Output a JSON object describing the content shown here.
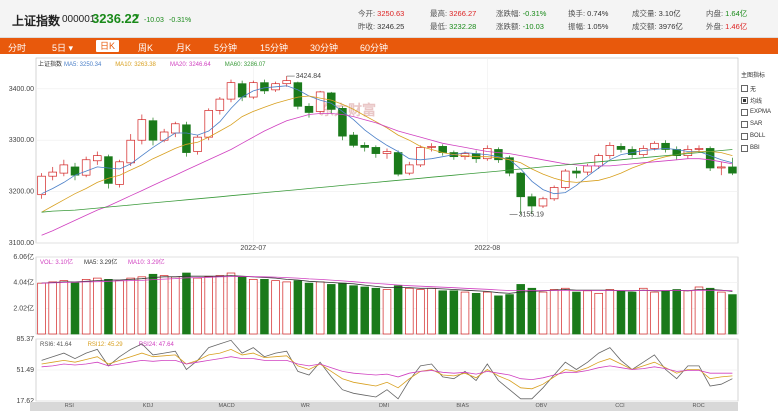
{
  "header": {
    "name": "上证指数",
    "code": "000001",
    "price": "3236.22",
    "arrow": "▼",
    "change": "-10.03",
    "change_pct": "-0.31%",
    "stats": [
      {
        "label": "今开:",
        "value": "3250.63",
        "tone": "red"
      },
      {
        "label": "最高:",
        "value": "3266.27",
        "tone": "red"
      },
      {
        "label": "涨跌幅:",
        "value": "-0.31%",
        "tone": "grn"
      },
      {
        "label": "换手:",
        "value": "0.74%",
        "tone": "normal"
      },
      {
        "label": "成交量:",
        "value": "3.10亿",
        "tone": "normal"
      },
      {
        "label": "内盘:",
        "value": "1.64亿",
        "tone": "grn"
      },
      {
        "label": "昨收:",
        "value": "3246.25",
        "tone": "normal"
      },
      {
        "label": "最低:",
        "value": "3232.28",
        "tone": "grn"
      },
      {
        "label": "涨跌额:",
        "value": "-10.03",
        "tone": "grn"
      },
      {
        "label": "振幅:",
        "value": "1.05%",
        "tone": "normal"
      },
      {
        "label": "成交额:",
        "value": "3976亿",
        "tone": "normal"
      },
      {
        "label": "外盘:",
        "value": "1.46亿",
        "tone": "red"
      }
    ]
  },
  "tabs": [
    {
      "label": "分时",
      "active": false
    },
    {
      "label": "5日 ▾",
      "active": false
    },
    {
      "label": "日K",
      "active": true
    },
    {
      "label": "周K",
      "active": false
    },
    {
      "label": "月K",
      "active": false
    },
    {
      "label": "5分钟",
      "active": false
    },
    {
      "label": "15分钟",
      "active": false
    },
    {
      "label": "30分钟",
      "active": false
    },
    {
      "label": "60分钟",
      "active": false
    }
  ],
  "sidebar": {
    "title": "主图指标",
    "options": [
      {
        "label": "无",
        "checked": false
      },
      {
        "label": "均线",
        "checked": true
      },
      {
        "label": "EXPMA",
        "checked": false
      },
      {
        "label": "SAR",
        "checked": false
      },
      {
        "label": "BOLL",
        "checked": false
      },
      {
        "label": "BBI",
        "checked": false
      }
    ]
  },
  "watermark": "东方财富",
  "index_bar": [
    "RSI",
    "KDJ",
    "MACD",
    "WR",
    "DMI",
    "BIAS",
    "OBV",
    "CCI",
    "ROC"
  ],
  "colors": {
    "up": "#d22222",
    "down": "#1a7a1a",
    "ma5": "#4a7fc8",
    "ma10": "#d8a020",
    "ma20": "#d040c0",
    "ma60": "#3a9a3a"
  },
  "chart_data": [
    {
      "type": "candlestick",
      "title": "上证指数",
      "legend": [
        {
          "name": "MA5",
          "value": "3250.34",
          "color": "#4a7fc8"
        },
        {
          "name": "MA10",
          "value": "3263.38",
          "color": "#d8a020"
        },
        {
          "name": "MA20",
          "value": "3246.64",
          "color": "#d040c0"
        },
        {
          "name": "MA60",
          "value": "3286.07",
          "color": "#3a9a3a"
        }
      ],
      "ylim": [
        3100,
        3460
      ],
      "yticks": [
        "3400.00",
        "3300.00",
        "3200.00",
        "3100.00"
      ],
      "ytick_values": [
        3400,
        3300,
        3200,
        3100
      ],
      "xticks": [
        {
          "index": 19,
          "label": "2022-07"
        },
        {
          "index": 40,
          "label": "2022-08"
        }
      ],
      "annotations": [
        {
          "index": 22,
          "value": 3424.84,
          "label": "3424.84"
        },
        {
          "index": 42,
          "value": 3155.19,
          "label": "3155.19"
        }
      ],
      "ohlc": [
        [
          3194,
          3230,
          3186,
          3236
        ],
        [
          3230,
          3238,
          3222,
          3248
        ],
        [
          3236,
          3252,
          3230,
          3262
        ],
        [
          3248,
          3232,
          3222,
          3256
        ],
        [
          3232,
          3262,
          3228,
          3268
        ],
        [
          3260,
          3270,
          3252,
          3278
        ],
        [
          3268,
          3216,
          3206,
          3272
        ],
        [
          3214,
          3258,
          3208,
          3262
        ],
        [
          3256,
          3300,
          3250,
          3312
        ],
        [
          3300,
          3340,
          3292,
          3350
        ],
        [
          3338,
          3300,
          3290,
          3344
        ],
        [
          3300,
          3316,
          3296,
          3322
        ],
        [
          3314,
          3332,
          3306,
          3336
        ],
        [
          3330,
          3276,
          3268,
          3336
        ],
        [
          3278,
          3306,
          3272,
          3310
        ],
        [
          3306,
          3358,
          3300,
          3362
        ],
        [
          3358,
          3380,
          3350,
          3384
        ],
        [
          3380,
          3412,
          3374,
          3418
        ],
        [
          3410,
          3384,
          3376,
          3416
        ],
        [
          3384,
          3412,
          3380,
          3416
        ],
        [
          3412,
          3396,
          3390,
          3418
        ],
        [
          3398,
          3410,
          3394,
          3414
        ],
        [
          3410,
          3416,
          3404,
          3425
        ],
        [
          3412,
          3366,
          3360,
          3414
        ],
        [
          3366,
          3354,
          3344,
          3372
        ],
        [
          3356,
          3394,
          3350,
          3396
        ],
        [
          3392,
          3360,
          3352,
          3394
        ],
        [
          3362,
          3308,
          3300,
          3366
        ],
        [
          3310,
          3290,
          3286,
          3316
        ],
        [
          3290,
          3286,
          3278,
          3296
        ],
        [
          3286,
          3274,
          3266,
          3290
        ],
        [
          3274,
          3278,
          3264,
          3284
        ],
        [
          3276,
          3234,
          3230,
          3280
        ],
        [
          3236,
          3252,
          3232,
          3258
        ],
        [
          3252,
          3286,
          3248,
          3290
        ],
        [
          3286,
          3288,
          3278,
          3294
        ],
        [
          3288,
          3276,
          3270,
          3292
        ],
        [
          3276,
          3268,
          3262,
          3280
        ],
        [
          3268,
          3274,
          3262,
          3278
        ],
        [
          3274,
          3264,
          3256,
          3280
        ],
        [
          3264,
          3284,
          3260,
          3290
        ],
        [
          3282,
          3262,
          3256,
          3286
        ],
        [
          3266,
          3236,
          3230,
          3270
        ],
        [
          3236,
          3190,
          3155,
          3238
        ],
        [
          3190,
          3172,
          3156,
          3196
        ],
        [
          3172,
          3186,
          3168,
          3190
        ],
        [
          3186,
          3208,
          3182,
          3212
        ],
        [
          3208,
          3240,
          3204,
          3244
        ],
        [
          3240,
          3236,
          3226,
          3248
        ],
        [
          3238,
          3250,
          3232,
          3254
        ],
        [
          3250,
          3270,
          3244,
          3274
        ],
        [
          3270,
          3290,
          3264,
          3296
        ],
        [
          3288,
          3282,
          3276,
          3294
        ],
        [
          3282,
          3272,
          3266,
          3288
        ],
        [
          3272,
          3284,
          3268,
          3290
        ],
        [
          3284,
          3294,
          3280,
          3298
        ],
        [
          3294,
          3282,
          3276,
          3300
        ],
        [
          3282,
          3270,
          3262,
          3288
        ],
        [
          3270,
          3282,
          3264,
          3290
        ],
        [
          3284,
          3284,
          3276,
          3290
        ],
        [
          3284,
          3246,
          3240,
          3288
        ],
        [
          3246,
          3248,
          3232,
          3258
        ],
        [
          3248,
          3236,
          3232,
          3266
        ]
      ],
      "ma5": [
        3196,
        3206,
        3218,
        3232,
        3240,
        3248,
        3246,
        3244,
        3254,
        3270,
        3286,
        3300,
        3314,
        3314,
        3310,
        3318,
        3336,
        3362,
        3384,
        3396,
        3402,
        3404,
        3406,
        3398,
        3386,
        3378,
        3372,
        3356,
        3340,
        3320,
        3304,
        3290,
        3278,
        3264,
        3262,
        3264,
        3268,
        3272,
        3276,
        3274,
        3272,
        3268,
        3262,
        3244,
        3220,
        3204,
        3196,
        3198,
        3212,
        3230,
        3246,
        3262,
        3272,
        3276,
        3280,
        3282,
        3284,
        3282,
        3278,
        3278,
        3270,
        3262,
        3256
      ],
      "ma10": [
        3160,
        3172,
        3184,
        3196,
        3206,
        3218,
        3226,
        3232,
        3242,
        3252,
        3264,
        3274,
        3284,
        3292,
        3296,
        3306,
        3318,
        3330,
        3346,
        3356,
        3364,
        3372,
        3378,
        3384,
        3386,
        3382,
        3378,
        3370,
        3360,
        3348,
        3336,
        3324,
        3310,
        3300,
        3288,
        3282,
        3276,
        3272,
        3270,
        3268,
        3268,
        3266,
        3262,
        3256,
        3244,
        3234,
        3226,
        3220,
        3218,
        3220,
        3222,
        3228,
        3236,
        3246,
        3254,
        3262,
        3268,
        3272,
        3276,
        3278,
        3278,
        3276,
        3270
      ],
      "ma20": [
        3115,
        3124,
        3134,
        3144,
        3154,
        3164,
        3172,
        3182,
        3192,
        3202,
        3212,
        3222,
        3232,
        3242,
        3252,
        3262,
        3272,
        3282,
        3294,
        3306,
        3318,
        3328,
        3338,
        3344,
        3350,
        3352,
        3352,
        3350,
        3346,
        3340,
        3334,
        3326,
        3318,
        3312,
        3306,
        3300,
        3294,
        3290,
        3286,
        3282,
        3278,
        3276,
        3274,
        3270,
        3266,
        3262,
        3258,
        3254,
        3252,
        3250,
        3250,
        3250,
        3252,
        3254,
        3256,
        3258,
        3260,
        3262,
        3264,
        3264,
        3262,
        3258,
        3254
      ],
      "ma60": [
        3160,
        3162,
        3163,
        3164,
        3166,
        3168,
        3170,
        3172,
        3174,
        3176,
        3178,
        3180,
        3182,
        3184,
        3186,
        3188,
        3190,
        3192,
        3194,
        3196,
        3198,
        3200,
        3202,
        3204,
        3206,
        3208,
        3210,
        3212,
        3214,
        3216,
        3218,
        3220,
        3222,
        3224,
        3226,
        3228,
        3230,
        3232,
        3234,
        3236,
        3238,
        3240,
        3242,
        3244,
        3246,
        3248,
        3250,
        3252,
        3254,
        3256,
        3258,
        3260,
        3262,
        3264,
        3266,
        3268,
        3270,
        3272,
        3274,
        3276,
        3278,
        3280,
        3282
      ]
    },
    {
      "type": "bar",
      "title": "VOL",
      "legend": [
        {
          "name": "VOL",
          "value": "3.10亿",
          "color": "#d040c0"
        },
        {
          "name": "MA5",
          "value": "3.29亿",
          "color": "#333333"
        },
        {
          "name": "MA10",
          "value": "3.29亿",
          "color": "#d040c0"
        }
      ],
      "unit": "亿",
      "ylim": [
        0,
        6.06
      ],
      "yticks": [
        "6.06亿",
        "4.04亿",
        "2.02亿"
      ],
      "ytick_values": [
        6.06,
        4.04,
        2.02
      ],
      "values": [
        4.0,
        4.1,
        4.2,
        4.1,
        4.3,
        4.4,
        4.3,
        4.2,
        4.4,
        4.5,
        4.7,
        4.6,
        4.5,
        4.8,
        4.4,
        4.5,
        4.6,
        4.8,
        4.5,
        4.3,
        4.3,
        4.2,
        4.1,
        4.2,
        4.0,
        4.1,
        3.9,
        4.0,
        3.8,
        3.7,
        3.6,
        3.5,
        3.8,
        3.6,
        3.5,
        3.6,
        3.4,
        3.4,
        3.3,
        3.2,
        3.3,
        3.0,
        3.1,
        3.9,
        3.6,
        3.3,
        3.5,
        3.6,
        3.3,
        3.4,
        3.2,
        3.5,
        3.4,
        3.3,
        3.6,
        3.3,
        3.4,
        3.5,
        3.4,
        3.7,
        3.6,
        3.3,
        3.1
      ],
      "ma5": [
        4.0,
        4.05,
        4.1,
        4.1,
        4.15,
        4.2,
        4.25,
        4.25,
        4.3,
        4.35,
        4.45,
        4.5,
        4.5,
        4.55,
        4.55,
        4.55,
        4.55,
        4.6,
        4.55,
        4.5,
        4.45,
        4.4,
        4.3,
        4.25,
        4.15,
        4.1,
        4.05,
        4.0,
        3.95,
        3.85,
        3.75,
        3.65,
        3.65,
        3.65,
        3.6,
        3.6,
        3.55,
        3.5,
        3.45,
        3.4,
        3.35,
        3.25,
        3.2,
        3.3,
        3.35,
        3.4,
        3.45,
        3.5,
        3.45,
        3.45,
        3.45,
        3.45,
        3.4,
        3.4,
        3.45,
        3.4,
        3.4,
        3.45,
        3.4,
        3.5,
        3.5,
        3.45,
        3.35
      ],
      "ma10": [
        4.0,
        4.02,
        4.05,
        4.08,
        4.1,
        4.12,
        4.15,
        4.18,
        4.2,
        4.22,
        4.28,
        4.32,
        4.36,
        4.42,
        4.44,
        4.46,
        4.5,
        4.52,
        4.52,
        4.52,
        4.5,
        4.48,
        4.44,
        4.4,
        4.34,
        4.3,
        4.24,
        4.18,
        4.12,
        4.04,
        3.98,
        3.92,
        3.86,
        3.8,
        3.76,
        3.72,
        3.68,
        3.64,
        3.6,
        3.56,
        3.52,
        3.46,
        3.42,
        3.42,
        3.42,
        3.42,
        3.42,
        3.42,
        3.42,
        3.42,
        3.42,
        3.42,
        3.42,
        3.42,
        3.42,
        3.42,
        3.42,
        3.42,
        3.42,
        3.42,
        3.42,
        3.42,
        3.42
      ]
    },
    {
      "type": "line",
      "title": "RSI",
      "legend": [
        {
          "name": "RSI6",
          "value": "41.64",
          "color": "#555555"
        },
        {
          "name": "RSI12",
          "value": "45.29",
          "color": "#d8a020"
        },
        {
          "name": "RSI24",
          "value": "47.64",
          "color": "#d040c0"
        }
      ],
      "ylim": [
        17.62,
        85.37
      ],
      "yticks": [
        "85.37",
        "51.49",
        "17.62"
      ],
      "ytick_values": [
        85.37,
        51.49,
        17.62
      ],
      "rsi6": [
        62,
        66,
        70,
        64,
        70,
        74,
        56,
        66,
        74,
        80,
        68,
        70,
        72,
        52,
        62,
        76,
        80,
        84,
        70,
        76,
        66,
        70,
        72,
        50,
        46,
        60,
        44,
        30,
        26,
        24,
        22,
        30,
        20,
        40,
        56,
        58,
        44,
        42,
        50,
        40,
        58,
        40,
        30,
        20,
        20,
        32,
        46,
        60,
        52,
        60,
        70,
        76,
        62,
        52,
        60,
        68,
        52,
        42,
        56,
        56,
        34,
        36,
        42
      ],
      "rsi12": [
        58,
        60,
        62,
        60,
        63,
        66,
        58,
        62,
        66,
        70,
        66,
        67,
        68,
        58,
        62,
        68,
        70,
        74,
        68,
        70,
        65,
        66,
        67,
        56,
        52,
        58,
        50,
        42,
        38,
        36,
        34,
        38,
        32,
        42,
        50,
        52,
        46,
        45,
        48,
        43,
        52,
        45,
        40,
        32,
        31,
        36,
        44,
        52,
        50,
        54,
        60,
        64,
        58,
        52,
        56,
        60,
        54,
        48,
        52,
        52,
        42,
        44,
        45
      ],
      "rsi24": [
        55,
        56,
        58,
        57,
        58,
        60,
        56,
        58,
        60,
        62,
        61,
        62,
        62,
        58,
        60,
        62,
        64,
        66,
        64,
        64,
        62,
        62,
        62,
        58,
        56,
        58,
        54,
        50,
        48,
        47,
        46,
        47,
        44,
        48,
        50,
        51,
        49,
        48,
        49,
        47,
        50,
        48,
        46,
        42,
        41,
        43,
        46,
        49,
        49,
        51,
        54,
        56,
        54,
        52,
        53,
        55,
        53,
        50,
        51,
        51,
        48,
        48,
        48
      ]
    }
  ]
}
